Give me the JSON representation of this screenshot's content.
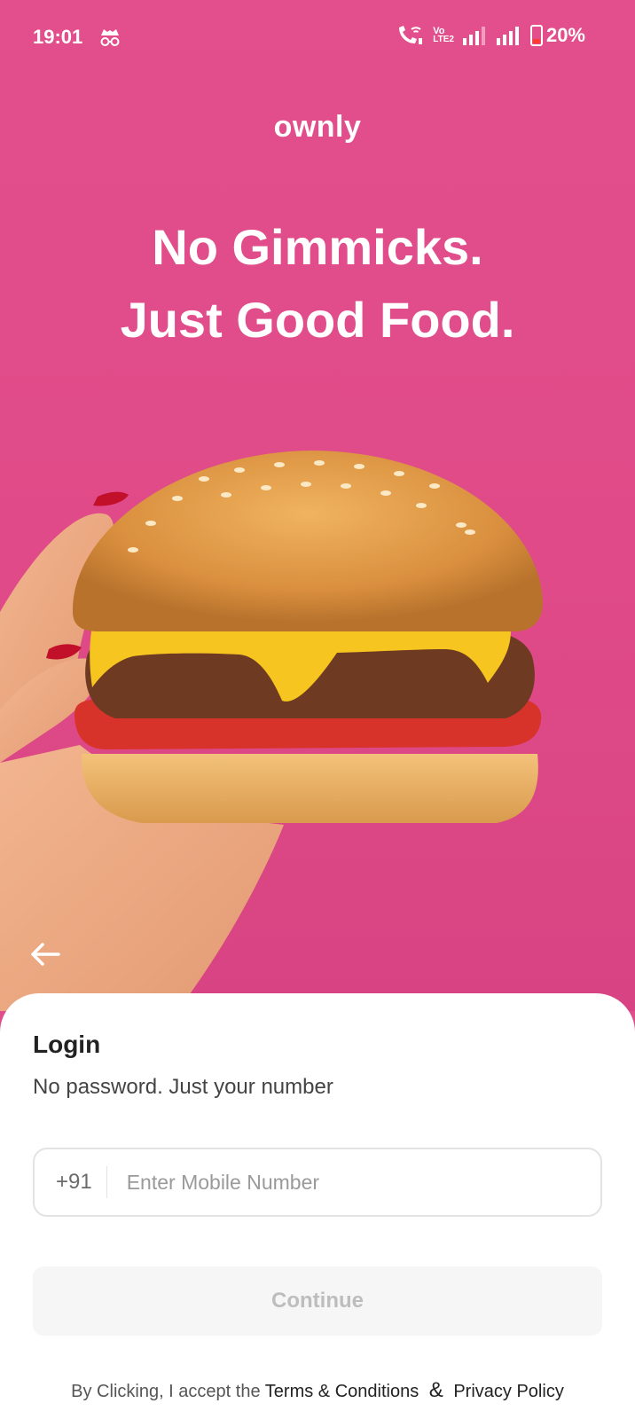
{
  "status_bar": {
    "time": "19:01",
    "network_label_top": "Vo",
    "network_label_bottom": "LTE2",
    "battery": "20%"
  },
  "brand": {
    "logo_text": "ownly"
  },
  "hero": {
    "headline_line1": "No Gimmicks.",
    "headline_line2": "Just Good Food."
  },
  "login": {
    "title": "Login",
    "subtitle": "No password. Just your number",
    "country_code": "+91",
    "mobile_placeholder": "Enter Mobile Number",
    "mobile_value": "",
    "continue_label": "Continue"
  },
  "legal": {
    "prefix": "By Clicking, I accept the",
    "terms": "Terms & Conditions",
    "ampersand": "&",
    "privacy": "Privacy Policy"
  },
  "colors": {
    "brand_pink": "#df4d8a",
    "sheet_bg": "#ffffff",
    "button_disabled_bg": "#f6f6f6",
    "button_disabled_text": "#bdbdbd"
  },
  "icons": {
    "incognito": "incognito-icon",
    "wifi_call": "wifi-calling-icon",
    "signal": "signal-icon",
    "battery": "battery-icon",
    "back": "back-arrow-icon"
  }
}
